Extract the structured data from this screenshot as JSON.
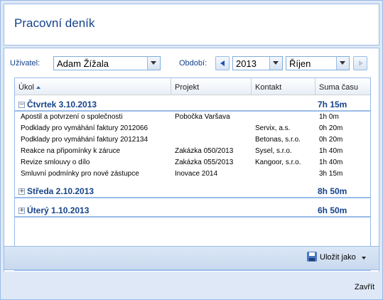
{
  "window": {
    "title": "Pracovní deník"
  },
  "filters": {
    "user_label": "Uživatel:",
    "user_value": "Adam Žížala",
    "period_label": "Období:",
    "year_value": "2013",
    "month_value": "Říjen"
  },
  "grid": {
    "columns": [
      "Úkol",
      "Projekt",
      "Kontakt",
      "Suma času"
    ],
    "groups": [
      {
        "name": "Čtvrtek 3.10.2013",
        "total": "7h 15m",
        "expanded": true,
        "rows": [
          {
            "task": "Apostil a potvrzení o společnosti",
            "project": "Pobočka Varšava",
            "contact": "",
            "time": "1h 0m"
          },
          {
            "task": "Podklady pro vymáhání faktury 2012066",
            "project": "",
            "contact": "Servix, a.s.",
            "time": "0h 20m"
          },
          {
            "task": "Podklady pro vymáhání faktury 2012134",
            "project": "",
            "contact": "Betonas, s.r.o.",
            "time": "0h 20m"
          },
          {
            "task": "Reakce na připomínky k záruce",
            "project": "Zakázka 050/2013",
            "contact": "Sysel, s.r.o.",
            "time": "1h 40m"
          },
          {
            "task": "Revize smlouvy o dílo",
            "project": "Zakázka 055/2013",
            "contact": "Kangoor, s.r.o.",
            "time": "1h 40m"
          },
          {
            "task": "Smluvní podmínky pro nové zástupce",
            "project": "Inovace 2014",
            "contact": "",
            "time": "3h 15m"
          }
        ]
      },
      {
        "name": "Středa 2.10.2013",
        "total": "8h 50m",
        "expanded": false,
        "rows": []
      },
      {
        "name": "Úterý 1.10.2013",
        "total": "6h 50m",
        "expanded": false,
        "rows": []
      }
    ]
  },
  "toolbar": {
    "save_label": "Uložit jako"
  },
  "footer": {
    "close_label": "Zavřít"
  },
  "icons": {
    "collapse": "minus-square-icon",
    "expand": "plus-square-icon",
    "save": "floppy-disk-icon"
  }
}
